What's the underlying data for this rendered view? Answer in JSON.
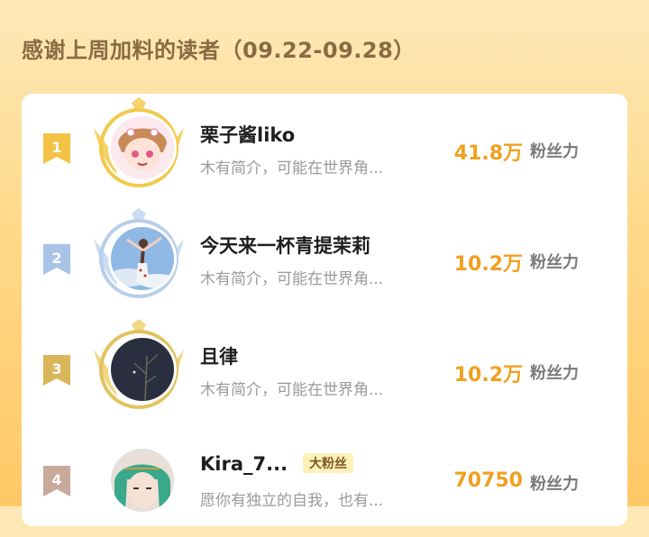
{
  "header": {
    "title": "感谢上周加料的读者（09.22-09.28）"
  },
  "score_label": "粉丝力",
  "readers": [
    {
      "rank": "1",
      "name": "栗子酱liko",
      "desc": "木有简介，可能在世界角...",
      "score": "41.8万",
      "badge_color": "#f4c245",
      "avatar": "anime-girl-avatar"
    },
    {
      "rank": "2",
      "name": "今天来一杯青提茉莉",
      "desc": "木有简介，可能在世界角...",
      "score": "10.2万",
      "badge_color": "#a9c4e6",
      "avatar": "girl-sky-avatar"
    },
    {
      "rank": "3",
      "name": "且律",
      "desc": "木有简介，可能在世界角...",
      "score": "10.2万",
      "badge_color": "#d9b65a",
      "avatar": "dark-plant-avatar"
    },
    {
      "rank": "4",
      "name": "Kira_7...",
      "tag": "大粉丝",
      "desc": "愿你有独立的自我，也有...",
      "score": "70750",
      "badge_color": "#c9a99a",
      "avatar": "anime-green-hair-avatar"
    }
  ]
}
